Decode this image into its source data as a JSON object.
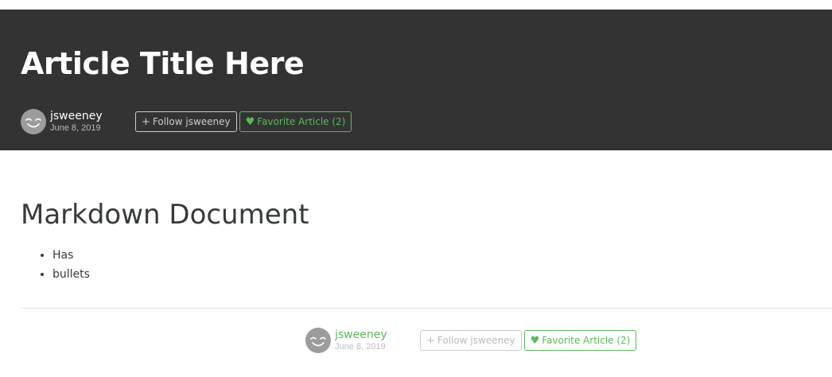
{
  "article": {
    "title": "Article Title Here",
    "author": "jsweeney",
    "date": "June 8, 2019",
    "follow_label": "Follow jsweeney",
    "favorite_label": "Favorite Article (2)"
  },
  "body": {
    "heading": "Markdown Document",
    "bullets": [
      "Has",
      "bullets"
    ]
  },
  "icons": {
    "follow": "plus-icon",
    "favorite": "heart-icon",
    "avatar": "smiley-icon"
  },
  "colors": {
    "banner": "#333333",
    "accent": "#5cb85c",
    "text": "#373a3c"
  }
}
